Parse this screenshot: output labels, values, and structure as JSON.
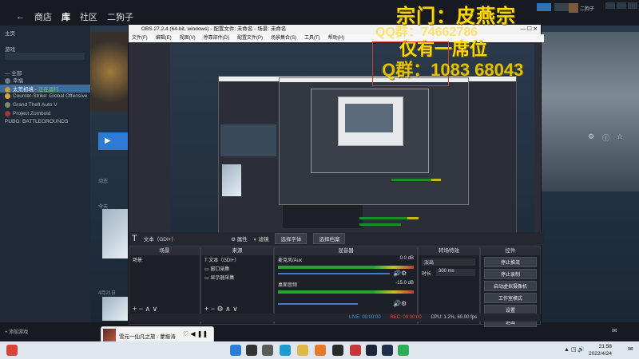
{
  "steam": {
    "nav": [
      "商店",
      "库",
      "社区",
      "二狗子"
    ],
    "home_label": "主页",
    "filter_label": "游戏",
    "sidebar": {
      "group": "— 全部",
      "items": [
        {
          "label": "幸福",
          "status": ""
        },
        {
          "label": "太荒初境",
          "status": "正在运行"
        },
        {
          "label": "Counter-Strike: Global Offensive",
          "status": ""
        },
        {
          "label": "Grand Theft Auto V",
          "status": ""
        },
        {
          "label": "Project Zomboid",
          "status": ""
        },
        {
          "label": "PUBG: BATTLEGROUNDS",
          "status": ""
        }
      ]
    },
    "add_game": "添加游戏",
    "activity": "动态",
    "date_label": "4月21日",
    "today": "今天",
    "user_tag": "二狗子"
  },
  "overlay": {
    "sect": "宗门：皮燕宗",
    "qq_small": "QQ群：74662786",
    "only_seat": "仅有一席位",
    "qq_big": "Q群：1083 68043"
  },
  "obs": {
    "title": "OBS 27.2.4 (64-bit, windows) - 配置文件: 未命名 - 场景: 未命名",
    "menu": [
      "文件(F)",
      "编辑(E)",
      "视图(V)",
      "停靠部件(D)",
      "配置文件(P)",
      "场景集合(S)",
      "工具(T)",
      "帮助(H)"
    ],
    "toolbar": {
      "source_name": "文本（GDI+）",
      "properties": "属性",
      "filters": "滤镜",
      "select_font": "选择字体",
      "select_file": "选择档案"
    },
    "panels": {
      "scenes": {
        "title": "场景",
        "items": [
          "场景"
        ]
      },
      "sources": {
        "title": "来源",
        "items": [
          "文本（GDI+）",
          "窗口采集",
          "显示器采集"
        ]
      },
      "mixer": {
        "title": "混音器",
        "channels": [
          {
            "name": "麦克风/Aux",
            "db": "0.0 dB"
          },
          {
            "name": "桌面音频",
            "db": "-15.0 dB"
          }
        ]
      },
      "transitions": {
        "title": "转场特效",
        "type": "淡出",
        "duration_label": "时长",
        "duration": "300 ms"
      },
      "controls": {
        "title": "控件",
        "buttons": [
          "停止推流",
          "停止录制",
          "启动虚拟摄像机",
          "工作室模式",
          "设置",
          "退出"
        ]
      }
    },
    "status": {
      "live": "LIVE: 00:00:00",
      "rec": "REC: 00:00:00",
      "cpu": "CPU: 1.2%, 60.00 fps"
    }
  },
  "music": {
    "title": "雪元一仙凡之旅 - 蒙振涛"
  },
  "taskbar": {
    "time": "21:58",
    "date": "2022/4/24"
  }
}
